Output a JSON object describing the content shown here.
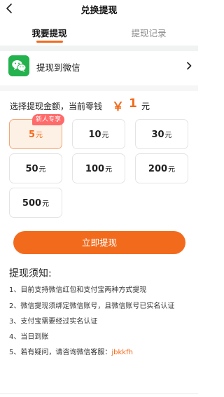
{
  "header": {
    "title": "兑换提现"
  },
  "tabs": [
    {
      "label": "我要提现",
      "active": true
    },
    {
      "label": "提现记录",
      "active": false
    }
  ],
  "method": {
    "label": "提现到微信",
    "icon": "wechat-icon"
  },
  "amount": {
    "label": "选择提现金额，当前零钱",
    "currency": "￥",
    "balance": "1",
    "unit": "元"
  },
  "options": [
    {
      "value": "5",
      "unit": "元",
      "selected": true,
      "badge": "新人专享"
    },
    {
      "value": "10",
      "unit": "元"
    },
    {
      "value": "30",
      "unit": "元"
    },
    {
      "value": "50",
      "unit": "元"
    },
    {
      "value": "100",
      "unit": "元"
    },
    {
      "value": "200",
      "unit": "元"
    },
    {
      "value": "500",
      "unit": "元"
    }
  ],
  "submit_label": "立即提现",
  "notice": {
    "title": "提现须知:",
    "items": [
      "1、目前支持微信红包和支付宝两种方式提现",
      "2、微信提现须绑定微信账号，且微信账号已实名认证",
      "3、支付宝需要经过实名认证",
      "4、当日到账",
      "5、若有疑问，请咨询微信客服："
    ],
    "service_id": "jbkkfh"
  },
  "colors": {
    "accent": "#f26b1d",
    "wechat": "#24b24e",
    "badge": "#ff6a6a"
  }
}
